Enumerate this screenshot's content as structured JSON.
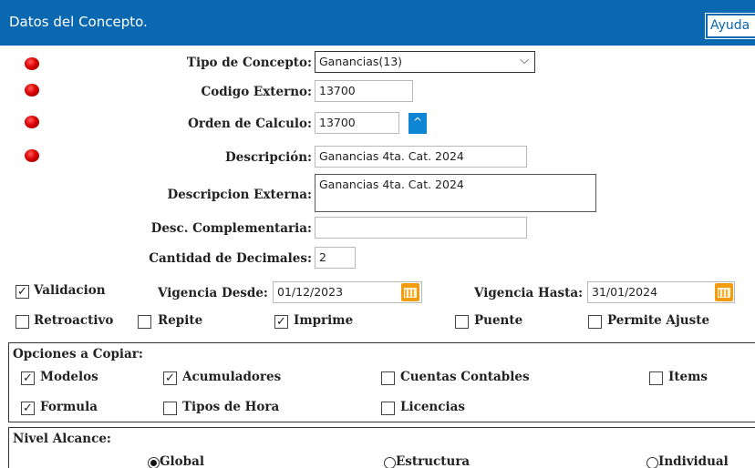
{
  "header": {
    "title": "Datos del Concepto.",
    "help_label": "Ayuda"
  },
  "form": {
    "tipo_concepto": {
      "label": "Tipo de Concepto:",
      "value": "Ganancias(13)"
    },
    "codigo_externo": {
      "label": "Codigo Externo:",
      "value": "13700"
    },
    "orden_calculo": {
      "label": "Orden de Calculo:",
      "value": "13700",
      "button": "^"
    },
    "descripcion": {
      "label": "Descripción:",
      "value": "Ganancias 4ta. Cat. 2024"
    },
    "descripcion_externa": {
      "label": "Descripcion Externa:",
      "value": "Ganancias 4ta. Cat. 2024"
    },
    "desc_complementaria": {
      "label": "Desc. Complementaria:",
      "value": ""
    },
    "cantidad_decimales": {
      "label": "Cantidad de Decimales:",
      "value": "2"
    }
  },
  "validacion": {
    "label": "Validacion",
    "checked": true
  },
  "vigencia_desde": {
    "label": "Vigencia Desde:",
    "value": "01/12/2023"
  },
  "vigencia_hasta": {
    "label": "Vigencia Hasta:",
    "value": "31/01/2024"
  },
  "flags": {
    "retroactivo": {
      "label": "Retroactivo",
      "checked": false
    },
    "repite": {
      "label": "Repite",
      "checked": false
    },
    "imprime": {
      "label": "Imprime",
      "checked": true
    },
    "puente": {
      "label": "Puente",
      "checked": false
    },
    "permite_ajuste": {
      "label": "Permite Ajuste",
      "checked": false
    }
  },
  "opciones_copiar": {
    "title": "Opciones a Copiar:",
    "modelos": {
      "label": "Modelos",
      "checked": true
    },
    "acumuladores": {
      "label": "Acumuladores",
      "checked": true
    },
    "cuentas_contables": {
      "label": "Cuentas Contables",
      "checked": false
    },
    "items": {
      "label": "Items",
      "checked": false
    },
    "formula": {
      "label": "Formula",
      "checked": true
    },
    "tipos_hora": {
      "label": "Tipos de Hora",
      "checked": false
    },
    "licencias": {
      "label": "Licencias",
      "checked": false
    }
  },
  "nivel_alcance": {
    "title": "Nivel Alcance:",
    "global": {
      "label": "Global",
      "selected": true
    },
    "estructura": {
      "label": "Estructura",
      "selected": false
    },
    "individual": {
      "label": "Individual",
      "selected": false
    }
  },
  "icons": {
    "required": "red-dot-icon",
    "calendar": "calendar-icon",
    "checkmark": "✓"
  },
  "colors": {
    "header_bg": "#0a68b0",
    "accent": "#0e86d4",
    "required_dot": "#d90000",
    "calendar": "#f39c12"
  }
}
